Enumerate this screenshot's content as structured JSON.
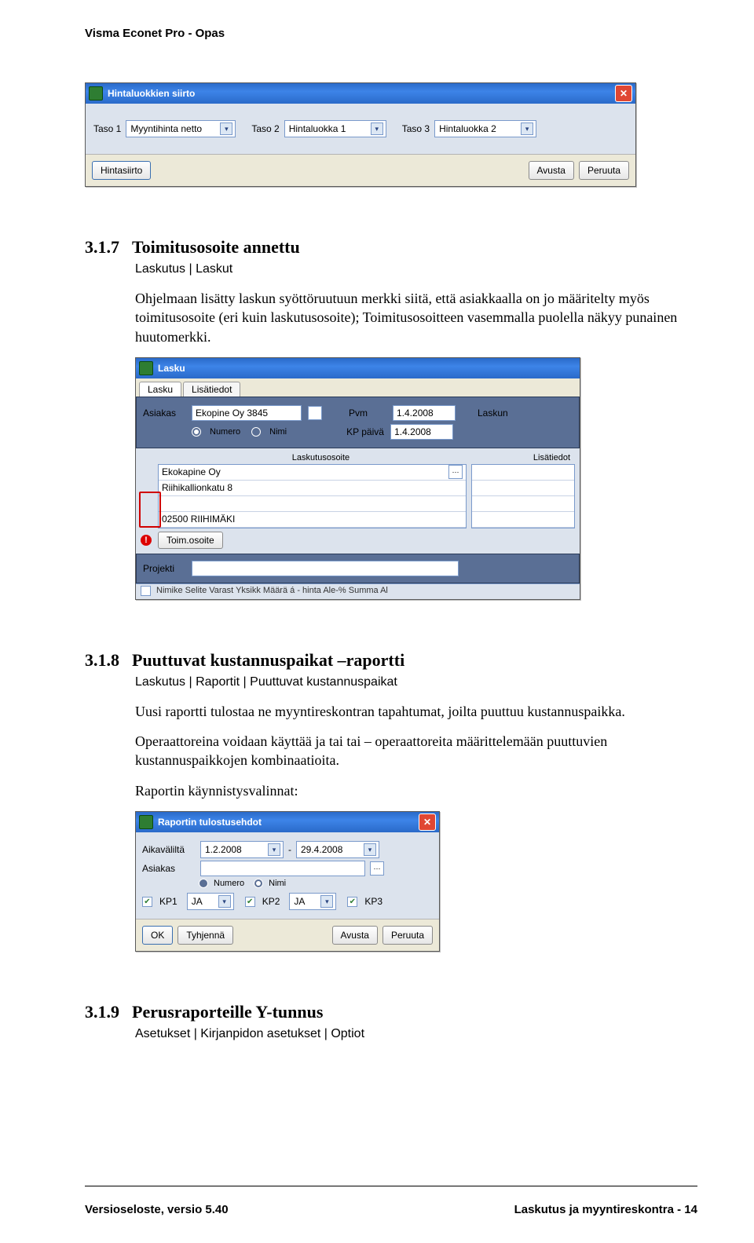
{
  "doc": {
    "header": "Visma Econet Pro - Opas",
    "footer_left": "Versioseloste, versio 5.40",
    "footer_right": "Laskutus ja myyntireskontra - 14"
  },
  "s317": {
    "number": "3.1.7",
    "title": "Toimitusosoite annettu",
    "breadcrumb": "Laskutus | Laskut",
    "p1": "Ohjelmaan lisätty laskun syöttöruutuun merkki siitä, että asiakkaalla on jo määritelty myös toimitusosoite (eri kuin laskutusosoite); Toimitusosoitteen vasemmalla puolella näkyy punainen huutomerkki."
  },
  "shot1": {
    "title": "Hintaluokkien siirto",
    "taso1_lbl": "Taso 1",
    "taso1_val": "Myyntihinta netto",
    "taso2_lbl": "Taso 2",
    "taso2_val": "Hintaluokka 1",
    "taso3_lbl": "Taso 3",
    "taso3_val": "Hintaluokka 2",
    "btn_do": "Hintasiirto",
    "btn_help": "Avusta",
    "btn_cancel": "Peruuta"
  },
  "shot2": {
    "title": "Lasku",
    "tab1": "Lasku",
    "tab2": "Lisätiedot",
    "asiakas_lbl": "Asiakas",
    "asiakas_val": "Ekopine Oy 3845",
    "radio_numero": "Numero",
    "radio_nimi": "Nimi",
    "pvm_lbl": "Pvm",
    "pvm_val": "1.4.2008",
    "kp_lbl": "KP päivä",
    "kp_val": "1.4.2008",
    "laskun_lbl": "Laskun",
    "col_lasku": "Laskutusosoite",
    "col_lisat": "Lisätiedot",
    "rows": [
      "Ekokapine Oy",
      "Riihikallionkatu 8",
      "",
      "02500 RIIHIMÄKI"
    ],
    "toim_btn": "Toim.osoite",
    "projekti_lbl": "Projekti",
    "gridcols": "Nimike    Selite               Varast Yksikk Määrä   á - hinta    Ale-%   Summa        Al"
  },
  "s318": {
    "number": "3.1.8",
    "title": "Puuttuvat kustannuspaikat –raportti",
    "breadcrumb": "Laskutus | Raportit | Puuttuvat kustannuspaikat",
    "p1": "Uusi raportti tulostaa ne myyntireskontran tapahtumat, joilta puuttuu kustannuspaikka.",
    "p2": "Operaattoreina voidaan käyttää ja tai tai – operaattoreita määrittelemään puuttuvien kustannuspaikkojen kombinaatioita.",
    "p3": "Raportin käynnistysvalinnat:"
  },
  "shot3": {
    "title": "Raportin tulostusehdot",
    "aika_lbl": "Aikaväliltä",
    "aika_from": "1.2.2008",
    "aika_sep": "-",
    "aika_to": "29.4.2008",
    "asiakas_lbl": "Asiakas",
    "asiakas_val": "",
    "radio_numero": "Numero",
    "radio_nimi": "Nimi",
    "kp1": "KP1",
    "sep1": "JA",
    "kp2": "KP2",
    "sep2": "JA",
    "kp3": "KP3",
    "btn_ok": "OK",
    "btn_clear": "Tyhjennä",
    "btn_help": "Avusta",
    "btn_cancel": "Peruuta"
  },
  "s319": {
    "number": "3.1.9",
    "title": "Perusraporteille Y-tunnus",
    "breadcrumb": "Asetukset | Kirjanpidon asetukset | Optiot"
  }
}
